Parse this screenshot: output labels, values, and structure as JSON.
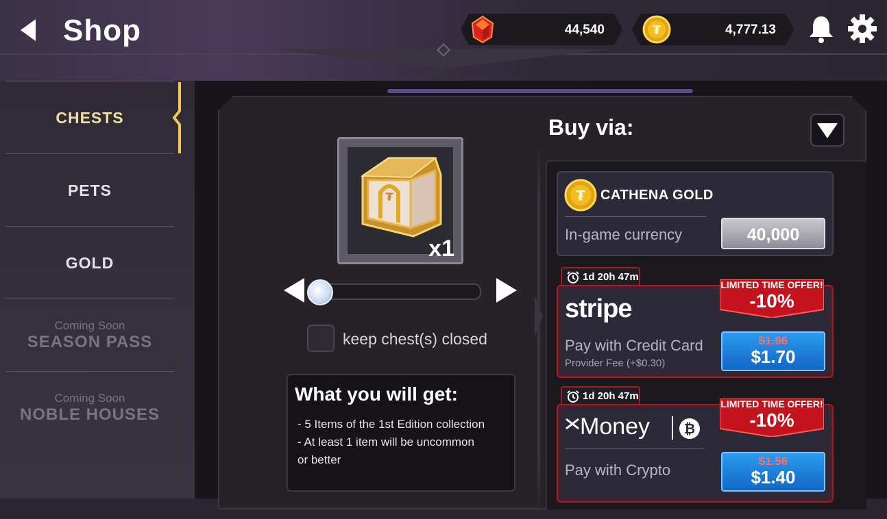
{
  "header": {
    "title": "Shop",
    "gems": "44,540",
    "gold": "4,777.13"
  },
  "sidebar": {
    "items": [
      {
        "label": "CHESTS",
        "active": true
      },
      {
        "label": "PETS"
      },
      {
        "label": "GOLD"
      },
      {
        "label": "SEASON PASS",
        "note": "Coming Soon"
      },
      {
        "label": "NOBLE HOUSES",
        "note": "Coming Soon"
      }
    ]
  },
  "chest": {
    "quantity": "x1",
    "keep_closed_label": "keep chest(s) closed"
  },
  "what_you_get": {
    "title": "What you will get:",
    "lines": [
      "- 5 Items of the 1st Edition collection",
      "- At least 1 item will be uncommon",
      "or better"
    ]
  },
  "buy_via": {
    "title": "Buy via:",
    "options": [
      {
        "name": "CATHENA GOLD",
        "description": "In-game currency",
        "price": "40,000"
      },
      {
        "timer": "1d 20h 47m",
        "brand": "stripe",
        "description": "Pay with Credit Card",
        "fee": "Provider Fee (+$0.30)",
        "offer_label": "LIMITED TIME OFFER!",
        "offer_pct": "-10%",
        "old_price": "$1.86",
        "price": "$1.70"
      },
      {
        "timer": "1d 20h 47m",
        "brand": "Money",
        "description": "Pay with Crypto",
        "offer_label": "LIMITED TIME OFFER!",
        "offer_pct": "-10%",
        "old_price": "$1.56",
        "price": "$1.40"
      }
    ]
  },
  "colors": {
    "accent_gold": "#f3dea0",
    "offer_red": "#c4131c",
    "buy_blue": "#1a82e0"
  }
}
